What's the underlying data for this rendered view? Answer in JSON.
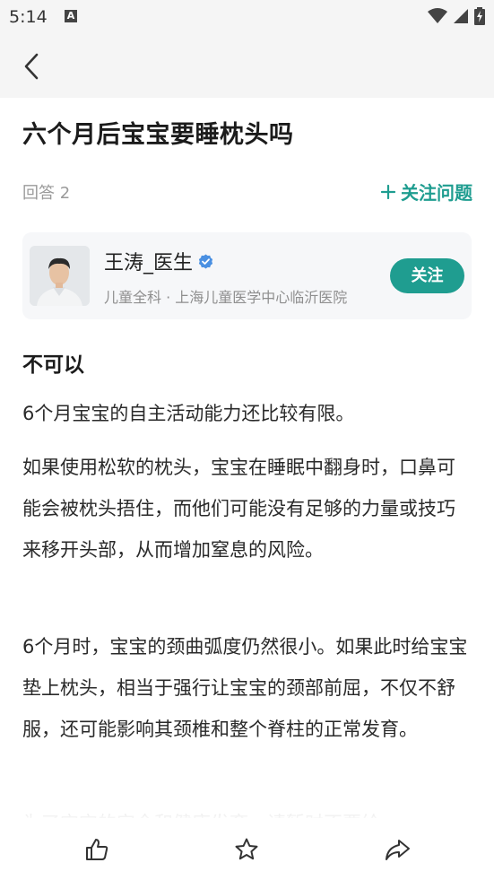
{
  "status_bar": {
    "time": "5:14",
    "notification_icon": "A",
    "icons": [
      "wifi-icon",
      "signal-icon",
      "battery-charging-icon"
    ]
  },
  "nav": {
    "back_icon": "chevron-left-icon"
  },
  "question": {
    "title": "六个月后宝宝要睡枕头吗",
    "answers_count": "回答 2",
    "follow_question_label": "关注问题"
  },
  "doctor": {
    "name": "王涛_医生",
    "verified": "verified-badge-icon",
    "description": "儿童全科 · 上海儿童医学中心临沂医院",
    "follow_label": "关注"
  },
  "answer": {
    "heading": "不可以",
    "paragraphs": [
      "6个月宝宝的自主活动能力还比较有限。",
      "如果使用松软的枕头，宝宝在睡眠中翻身时，口鼻可能会被枕头捂住，而他们可能没有足够的力量或技巧来移开头部，从而增加窒息的风险。",
      "6个月时，宝宝的颈曲弧度仍然很小。如果此时给宝宝垫上枕头，相当于强行让宝宝的颈部前屈，不仅不舒服，还可能影响其颈椎和整个脊柱的正常发育。",
      "为了宝宝的安全和健康发育，请暂时不要给"
    ]
  },
  "bottom_bar": {
    "like": "thumbs-up-icon",
    "favorite": "star-icon",
    "share": "share-icon"
  },
  "colors": {
    "accent": "#1f9d90",
    "verified": "#4a90e2",
    "muted": "#9a9a9a"
  }
}
